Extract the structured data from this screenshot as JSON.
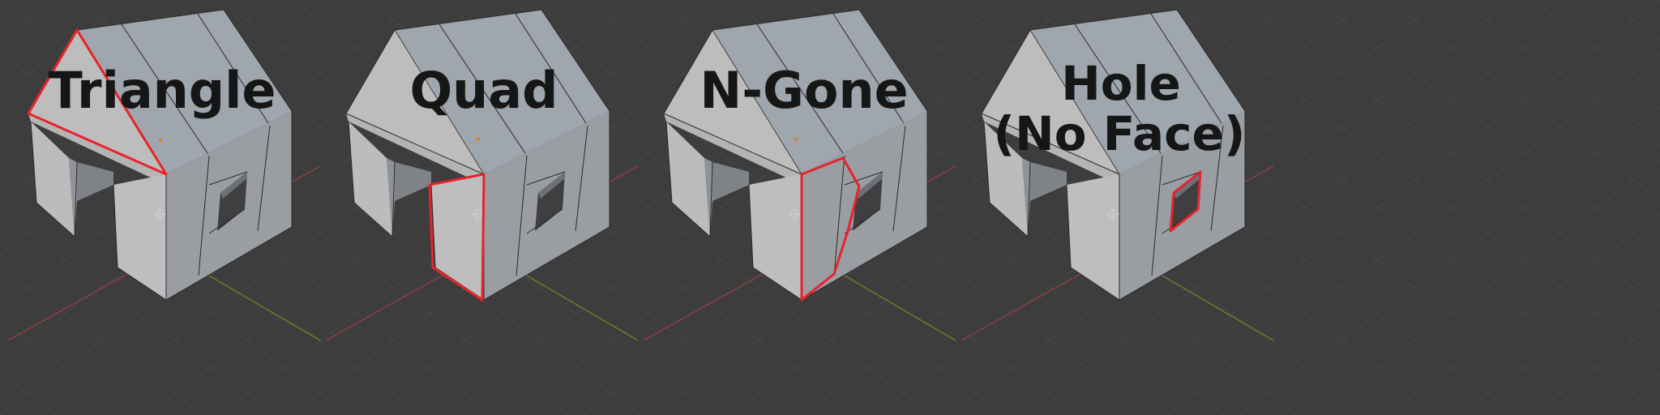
{
  "panels": [
    {
      "id": "triangle",
      "label_lines": [
        "Triangle"
      ]
    },
    {
      "id": "quad",
      "label_lines": [
        "Quad"
      ]
    },
    {
      "id": "ngon",
      "label_lines": [
        "N-Gone"
      ]
    },
    {
      "id": "hole",
      "label_lines": [
        "Hole",
        "(No Face)"
      ]
    }
  ],
  "colors": {
    "background": "#3d3d3d",
    "grid_line": "#474747",
    "x_axis": "#8c3f46",
    "y_axis": "#6a7f2a",
    "roof_front": "#a0a6ad",
    "gable": "#bdbdbd",
    "wall_front": "#bdbdbd",
    "wall_side": "#9a9ea3",
    "selection_outline": "#e8232b",
    "mesh_edge": "#2a2a2a",
    "label_text": "#161616"
  }
}
